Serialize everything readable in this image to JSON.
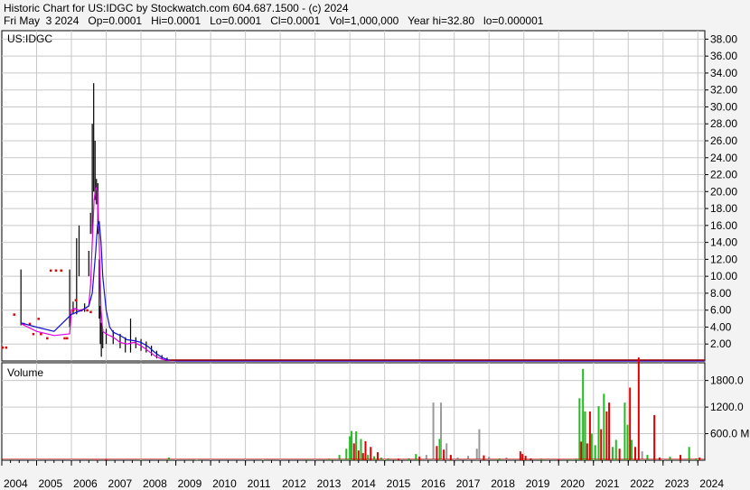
{
  "header": {
    "line1": "Historic Chart for US:IDGC by Stockwatch.com 604.687.1500 - (c) 2024",
    "line2": "Fri May  3 2024   Op=0.0001   Hi=0.0001   Lo=0.0001   Cl=0.0001   Vol=1,000,000   Year hi=32.80   lo=0.000001"
  },
  "price_panel": {
    "symbol_label": "US:IDGC"
  },
  "volume_panel": {
    "label": "Volume",
    "unit_suffix": "M"
  },
  "colors": {
    "background": "#f3f3f3",
    "grid": "#c8c8c8",
    "price_bar": "#000000",
    "ma_short": "#e000e0",
    "ma_long": "#1010d0",
    "baseline": "#a00000",
    "red_point": "#dd0000",
    "vol_up": "#22bb22",
    "vol_down": "#dd0000",
    "vol_flat": "#999999"
  },
  "chart_data": [
    {
      "type": "line",
      "panel": "price",
      "title": "Historic Chart for US:IDGC",
      "x_unit": "year",
      "xlim": [
        2004.0,
        2024.2
      ],
      "ylim": [
        0,
        39
      ],
      "y_ticks": [
        "2.00",
        "4.00",
        "6.00",
        "8.00",
        "10.00",
        "12.00",
        "14.00",
        "16.00",
        "18.00",
        "20.00",
        "22.00",
        "24.00",
        "26.00",
        "28.00",
        "30.00",
        "32.00",
        "34.00",
        "36.00",
        "38.00"
      ],
      "x_ticks": [
        "2004",
        "2005",
        "2006",
        "2007",
        "2008",
        "2009",
        "2010",
        "2011",
        "2012",
        "2013",
        "2014",
        "2015",
        "2016",
        "2017",
        "2018",
        "2019",
        "2020",
        "2021",
        "2022",
        "2023",
        "2024"
      ],
      "price_bars": [
        {
          "x": 2004.55,
          "low": 4.2,
          "high": 10.8
        },
        {
          "x": 2005.95,
          "low": 4.0,
          "high": 10.8
        },
        {
          "x": 2006.05,
          "low": 5.5,
          "high": 7.0
        },
        {
          "x": 2006.15,
          "low": 5.5,
          "high": 14.5
        },
        {
          "x": 2006.22,
          "low": 10.0,
          "high": 16.0
        },
        {
          "x": 2006.38,
          "low": 5.8,
          "high": 6.8
        },
        {
          "x": 2006.5,
          "low": 10.0,
          "high": 13.0
        },
        {
          "x": 2006.55,
          "low": 15.0,
          "high": 17.5
        },
        {
          "x": 2006.6,
          "low": 15.0,
          "high": 28.0
        },
        {
          "x": 2006.64,
          "low": 20.0,
          "high": 32.8
        },
        {
          "x": 2006.68,
          "low": 19.0,
          "high": 26.0
        },
        {
          "x": 2006.72,
          "low": 18.5,
          "high": 21.5
        },
        {
          "x": 2006.76,
          "low": 15.0,
          "high": 21.0
        },
        {
          "x": 2006.8,
          "low": 5.0,
          "high": 12.0
        },
        {
          "x": 2006.83,
          "low": 2.0,
          "high": 6.5
        },
        {
          "x": 2006.86,
          "low": 0.5,
          "high": 4.5
        },
        {
          "x": 2006.9,
          "low": 1.5,
          "high": 3.8
        },
        {
          "x": 2007.0,
          "low": 2.0,
          "high": 3.8
        },
        {
          "x": 2007.2,
          "low": 2.0,
          "high": 3.6
        },
        {
          "x": 2007.4,
          "low": 1.5,
          "high": 3.2
        },
        {
          "x": 2007.55,
          "low": 1.0,
          "high": 2.8
        },
        {
          "x": 2007.7,
          "low": 1.0,
          "high": 5.0
        },
        {
          "x": 2007.85,
          "low": 1.5,
          "high": 2.8
        },
        {
          "x": 2008.0,
          "low": 1.2,
          "high": 2.6
        },
        {
          "x": 2008.15,
          "low": 1.0,
          "high": 2.3
        },
        {
          "x": 2008.3,
          "low": 0.6,
          "high": 1.8
        },
        {
          "x": 2008.45,
          "low": 0.3,
          "high": 1.2
        },
        {
          "x": 2008.6,
          "low": 0.2,
          "high": 0.7
        },
        {
          "x": 2008.75,
          "low": 0.1,
          "high": 0.4
        }
      ],
      "early_points": [
        {
          "x": 2004.02,
          "y": 1.6
        },
        {
          "x": 2004.12,
          "y": 1.6
        },
        {
          "x": 2004.35,
          "y": 5.5
        },
        {
          "x": 2004.62,
          "y": 4.4
        },
        {
          "x": 2004.8,
          "y": 4.4
        },
        {
          "x": 2004.9,
          "y": 3.2
        },
        {
          "x": 2005.05,
          "y": 5.0
        },
        {
          "x": 2005.12,
          "y": 3.2
        },
        {
          "x": 2005.3,
          "y": 2.7
        },
        {
          "x": 2005.4,
          "y": 10.7
        },
        {
          "x": 2005.55,
          "y": 10.7
        },
        {
          "x": 2005.7,
          "y": 10.7
        },
        {
          "x": 2005.8,
          "y": 2.7
        },
        {
          "x": 2005.87,
          "y": 2.7
        },
        {
          "x": 2006.05,
          "y": 6.0
        },
        {
          "x": 2006.12,
          "y": 7.2
        },
        {
          "x": 2006.28,
          "y": 6.0
        },
        {
          "x": 2006.45,
          "y": 6.0
        },
        {
          "x": 2006.55,
          "y": 5.8
        }
      ],
      "series": [
        {
          "x": [
            2004.55,
            2005.0,
            2005.5,
            2005.95,
            2006.0,
            2006.1,
            2006.2,
            2006.3,
            2006.4,
            2006.5,
            2006.55,
            2006.6,
            2006.65,
            2006.7,
            2006.75,
            2006.8,
            2006.85,
            2006.9,
            2007.0,
            2007.2,
            2007.4,
            2007.6,
            2007.8,
            2008.0,
            2008.2,
            2008.4,
            2008.6,
            2008.8,
            2009.0,
            2024.2
          ],
          "y": [
            4.4,
            3.5,
            3.0,
            3.2,
            6.0,
            6.2,
            6.0,
            6.0,
            6.2,
            6.5,
            9.0,
            14.0,
            19.0,
            20.5,
            20.0,
            14.0,
            6.0,
            3.5,
            3.2,
            2.8,
            2.2,
            2.0,
            2.2,
            1.8,
            1.2,
            0.6,
            0.2,
            0.05,
            0.0,
            0.0
          ]
        },
        {
          "x": [
            2004.55,
            2005.0,
            2005.5,
            2006.0,
            2006.3,
            2006.5,
            2006.6,
            2006.7,
            2006.75,
            2006.8,
            2006.85,
            2006.9,
            2007.0,
            2007.1,
            2007.2,
            2007.4,
            2007.6,
            2007.8,
            2008.0,
            2008.2,
            2008.4,
            2008.6,
            2008.8,
            2009.0,
            2024.2
          ],
          "y": [
            4.5,
            4.0,
            3.5,
            5.5,
            6.0,
            6.5,
            8.0,
            13.0,
            16.0,
            16.5,
            14.0,
            10.0,
            6.0,
            4.0,
            3.4,
            3.0,
            2.5,
            2.4,
            2.2,
            1.7,
            1.0,
            0.4,
            0.1,
            0.0,
            0.0
          ]
        }
      ]
    },
    {
      "type": "bar",
      "panel": "volume",
      "title": "Volume",
      "ylim": [
        0,
        2200
      ],
      "y_ticks": [
        "600.0",
        "1200.0",
        "1800.0"
      ],
      "bars": [
        {
          "x": 2005.0,
          "v": 5,
          "c": "g"
        },
        {
          "x": 2006.7,
          "v": 15,
          "c": "r"
        },
        {
          "x": 2007.0,
          "v": 20,
          "c": "r"
        },
        {
          "x": 2008.0,
          "v": 10,
          "c": "g"
        },
        {
          "x": 2008.8,
          "v": 60,
          "c": "g"
        },
        {
          "x": 2009.6,
          "v": 12,
          "c": "g"
        },
        {
          "x": 2011.5,
          "v": 8,
          "c": "g"
        },
        {
          "x": 2012.8,
          "v": 20,
          "c": "g"
        },
        {
          "x": 2013.4,
          "v": 30,
          "c": "g"
        },
        {
          "x": 2013.7,
          "v": 120,
          "c": "g"
        },
        {
          "x": 2013.9,
          "v": 260,
          "c": "g"
        },
        {
          "x": 2014.0,
          "v": 540,
          "c": "g"
        },
        {
          "x": 2014.05,
          "v": 660,
          "c": "g"
        },
        {
          "x": 2014.12,
          "v": 380,
          "c": "r"
        },
        {
          "x": 2014.18,
          "v": 650,
          "c": "g"
        },
        {
          "x": 2014.25,
          "v": 220,
          "c": "r"
        },
        {
          "x": 2014.32,
          "v": 480,
          "c": "g"
        },
        {
          "x": 2014.38,
          "v": 160,
          "c": "r"
        },
        {
          "x": 2014.45,
          "v": 430,
          "c": "r"
        },
        {
          "x": 2014.52,
          "v": 120,
          "c": "g"
        },
        {
          "x": 2014.6,
          "v": 300,
          "c": "r"
        },
        {
          "x": 2014.7,
          "v": 90,
          "c": "g"
        },
        {
          "x": 2014.8,
          "v": 180,
          "c": "r"
        },
        {
          "x": 2014.9,
          "v": 60,
          "c": "g"
        },
        {
          "x": 2015.1,
          "v": 40,
          "c": "g"
        },
        {
          "x": 2015.4,
          "v": 30,
          "c": "r"
        },
        {
          "x": 2015.7,
          "v": 40,
          "c": "g"
        },
        {
          "x": 2015.9,
          "v": 140,
          "c": "g"
        },
        {
          "x": 2016.0,
          "v": 80,
          "c": "r"
        },
        {
          "x": 2016.2,
          "v": 120,
          "c": "f"
        },
        {
          "x": 2016.4,
          "v": 1300,
          "c": "f"
        },
        {
          "x": 2016.5,
          "v": 320,
          "c": "r"
        },
        {
          "x": 2016.58,
          "v": 480,
          "c": "g"
        },
        {
          "x": 2016.62,
          "v": 1300,
          "c": "f"
        },
        {
          "x": 2016.7,
          "v": 240,
          "c": "r"
        },
        {
          "x": 2016.78,
          "v": 380,
          "c": "f"
        },
        {
          "x": 2016.9,
          "v": 120,
          "c": "r"
        },
        {
          "x": 2017.1,
          "v": 60,
          "c": "f"
        },
        {
          "x": 2017.4,
          "v": 100,
          "c": "f"
        },
        {
          "x": 2017.65,
          "v": 260,
          "c": "f"
        },
        {
          "x": 2017.72,
          "v": 700,
          "c": "f"
        },
        {
          "x": 2017.85,
          "v": 110,
          "c": "r"
        },
        {
          "x": 2018.0,
          "v": 80,
          "c": "f"
        },
        {
          "x": 2018.3,
          "v": 40,
          "c": "g"
        },
        {
          "x": 2018.5,
          "v": 60,
          "c": "f"
        },
        {
          "x": 2018.9,
          "v": 200,
          "c": "r"
        },
        {
          "x": 2018.96,
          "v": 140,
          "c": "r"
        },
        {
          "x": 2019.05,
          "v": 100,
          "c": "r"
        },
        {
          "x": 2019.2,
          "v": 40,
          "c": "r"
        },
        {
          "x": 2019.5,
          "v": 30,
          "c": "g"
        },
        {
          "x": 2019.7,
          "v": 30,
          "c": "f"
        },
        {
          "x": 2020.0,
          "v": 20,
          "c": "r"
        },
        {
          "x": 2020.3,
          "v": 20,
          "c": "g"
        },
        {
          "x": 2020.5,
          "v": 30,
          "c": "g"
        },
        {
          "x": 2020.6,
          "v": 1400,
          "c": "g"
        },
        {
          "x": 2020.65,
          "v": 420,
          "c": "r"
        },
        {
          "x": 2020.7,
          "v": 2060,
          "c": "g"
        },
        {
          "x": 2020.76,
          "v": 1100,
          "c": "g"
        },
        {
          "x": 2020.82,
          "v": 380,
          "c": "r"
        },
        {
          "x": 2020.9,
          "v": 1100,
          "c": "r"
        },
        {
          "x": 2020.95,
          "v": 600,
          "c": "g"
        },
        {
          "x": 2021.05,
          "v": 340,
          "c": "g"
        },
        {
          "x": 2021.15,
          "v": 1220,
          "c": "g"
        },
        {
          "x": 2021.22,
          "v": 700,
          "c": "r"
        },
        {
          "x": 2021.3,
          "v": 1500,
          "c": "g"
        },
        {
          "x": 2021.38,
          "v": 1100,
          "c": "r"
        },
        {
          "x": 2021.45,
          "v": 1300,
          "c": "r"
        },
        {
          "x": 2021.55,
          "v": 300,
          "c": "g"
        },
        {
          "x": 2021.65,
          "v": 460,
          "c": "g"
        },
        {
          "x": 2021.75,
          "v": 260,
          "c": "r"
        },
        {
          "x": 2021.9,
          "v": 1300,
          "c": "g"
        },
        {
          "x": 2021.98,
          "v": 800,
          "c": "g"
        },
        {
          "x": 2022.05,
          "v": 1640,
          "c": "r"
        },
        {
          "x": 2022.1,
          "v": 460,
          "c": "g"
        },
        {
          "x": 2022.2,
          "v": 300,
          "c": "r"
        },
        {
          "x": 2022.3,
          "v": 2320,
          "c": "r"
        },
        {
          "x": 2022.4,
          "v": 200,
          "c": "f"
        },
        {
          "x": 2022.55,
          "v": 120,
          "c": "g"
        },
        {
          "x": 2022.75,
          "v": 1020,
          "c": "r"
        },
        {
          "x": 2022.9,
          "v": 60,
          "c": "r"
        },
        {
          "x": 2023.2,
          "v": 80,
          "c": "g"
        },
        {
          "x": 2023.5,
          "v": 120,
          "c": "r"
        },
        {
          "x": 2023.75,
          "v": 300,
          "c": "g"
        },
        {
          "x": 2023.95,
          "v": 40,
          "c": "g"
        },
        {
          "x": 2024.05,
          "v": 60,
          "c": "r"
        }
      ]
    }
  ]
}
